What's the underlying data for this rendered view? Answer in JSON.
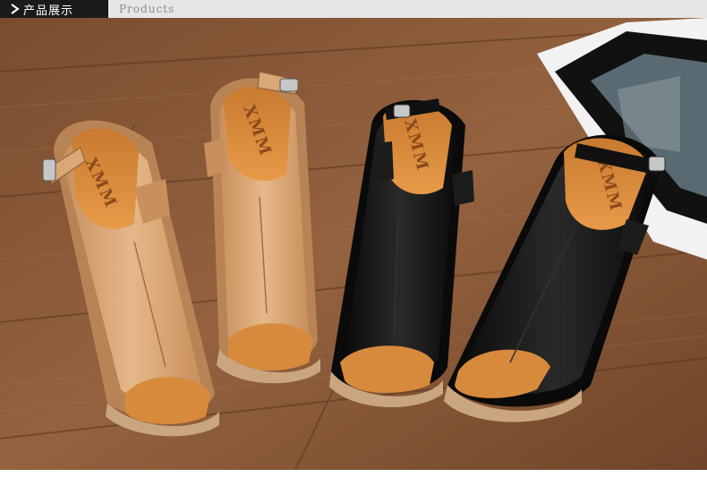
{
  "header": {
    "title_cn": "产品展示",
    "title_en": "Products",
    "chevron_icon": "chevron-right-icon",
    "tab_color": "#1a1a1a",
    "bar_color": "#e6e6e6"
  },
  "photo": {
    "brand_labels": [
      "XMM",
      "XMM",
      "XMM",
      "XMM"
    ],
    "colors": {
      "wood": "#8a5a3a",
      "tan_leather": "#d9a877",
      "black_leather": "#141414",
      "insole": "#d88a3c",
      "cork_sole": "#c9a680"
    }
  }
}
